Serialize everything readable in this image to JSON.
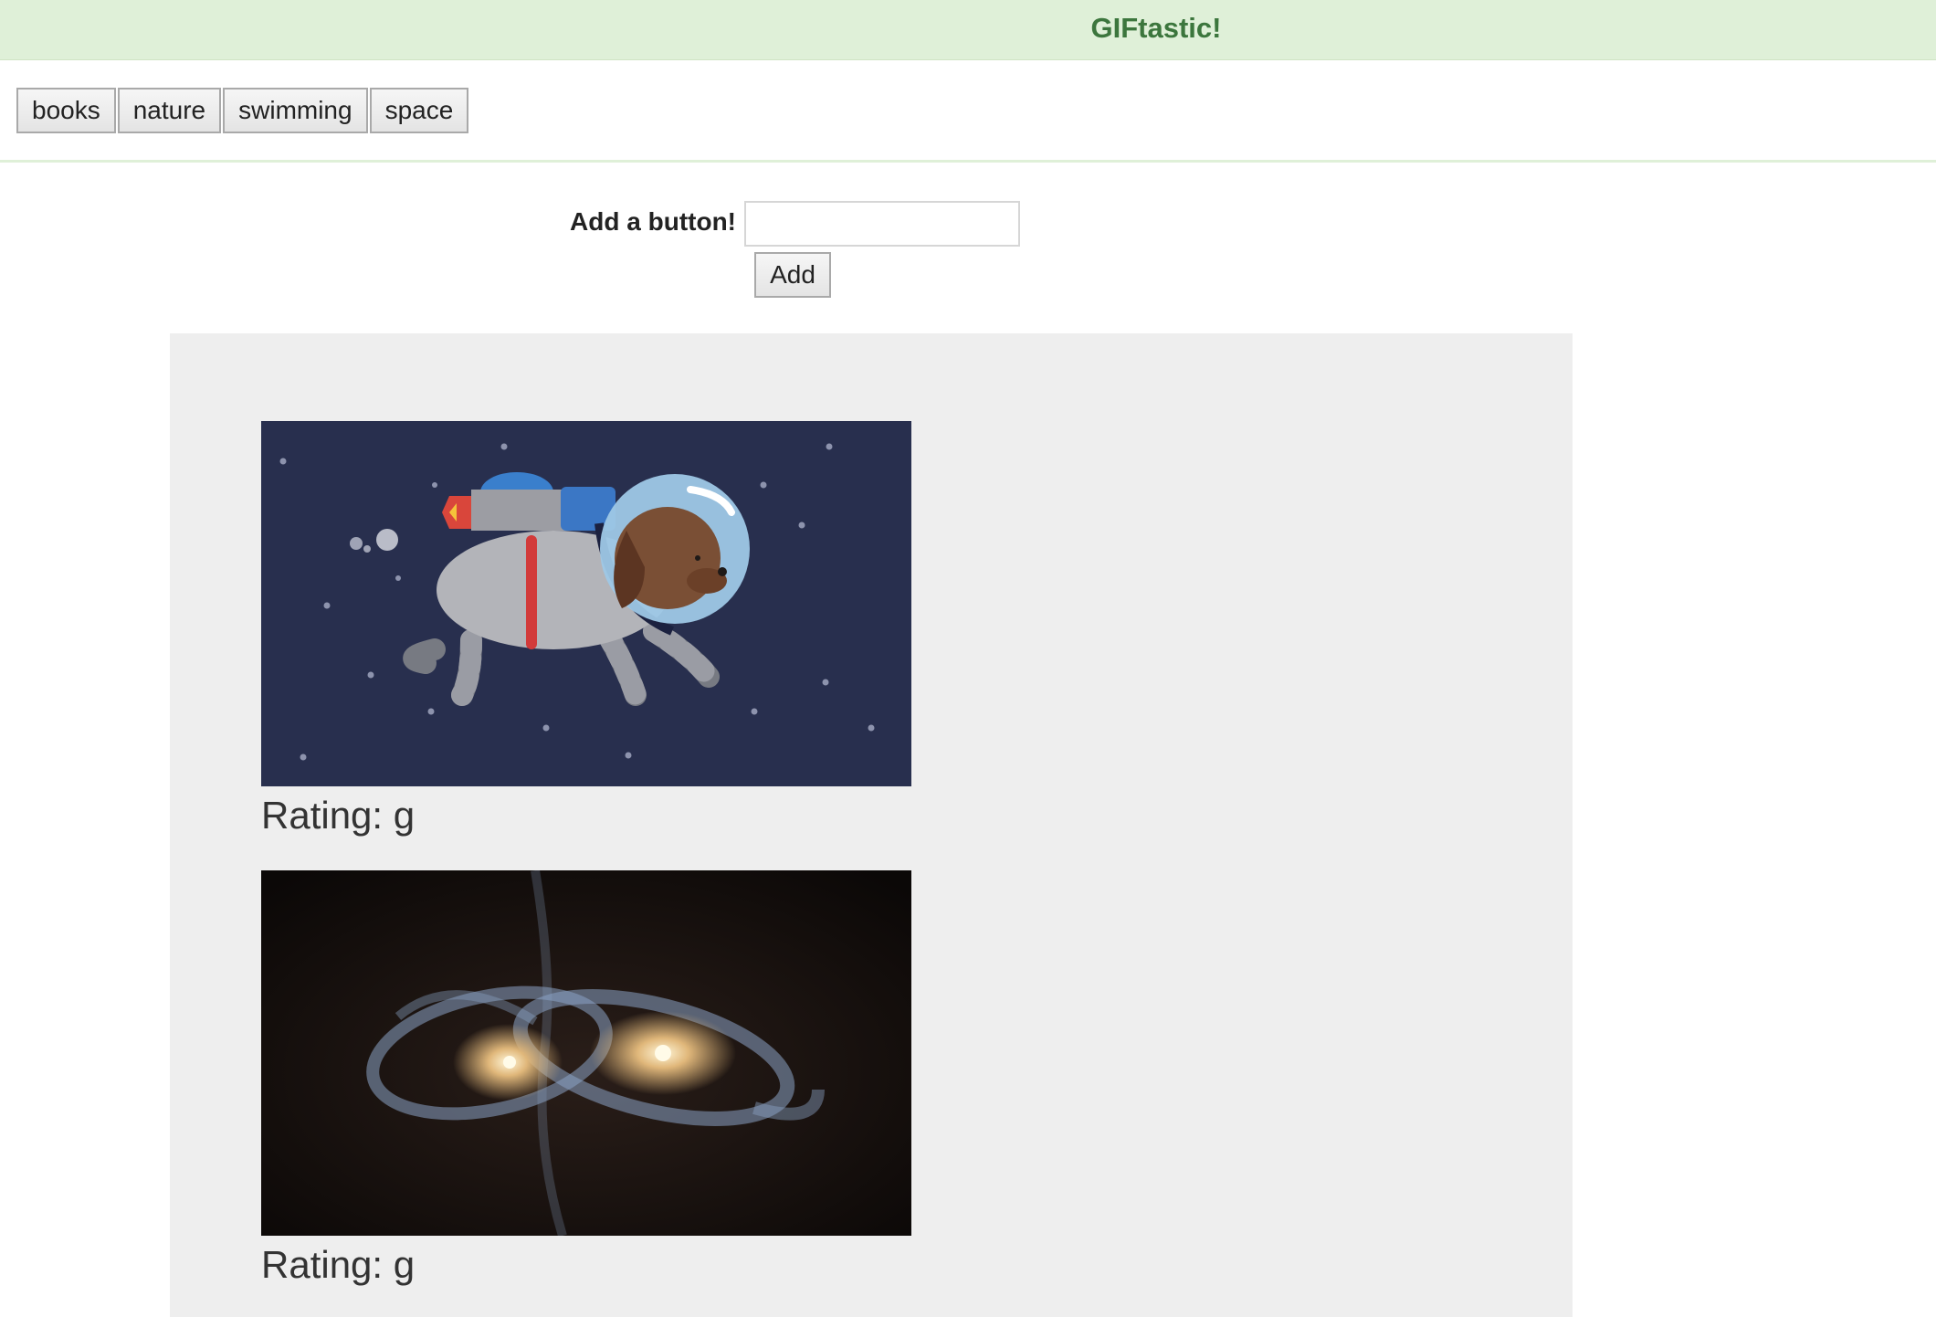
{
  "header": {
    "title": "GIFtastic!",
    "background_color": "#dff0d8",
    "title_color": "#3c763d"
  },
  "topics": [
    "books",
    "nature",
    "swimming",
    "space"
  ],
  "add_form": {
    "label": "Add a button!",
    "input_value": "",
    "button_label": "Add"
  },
  "gifs": [
    {
      "description": "space-dog-astronaut",
      "rating": "Rating: g"
    },
    {
      "description": "colliding-galaxies",
      "rating": "Rating: g"
    }
  ]
}
